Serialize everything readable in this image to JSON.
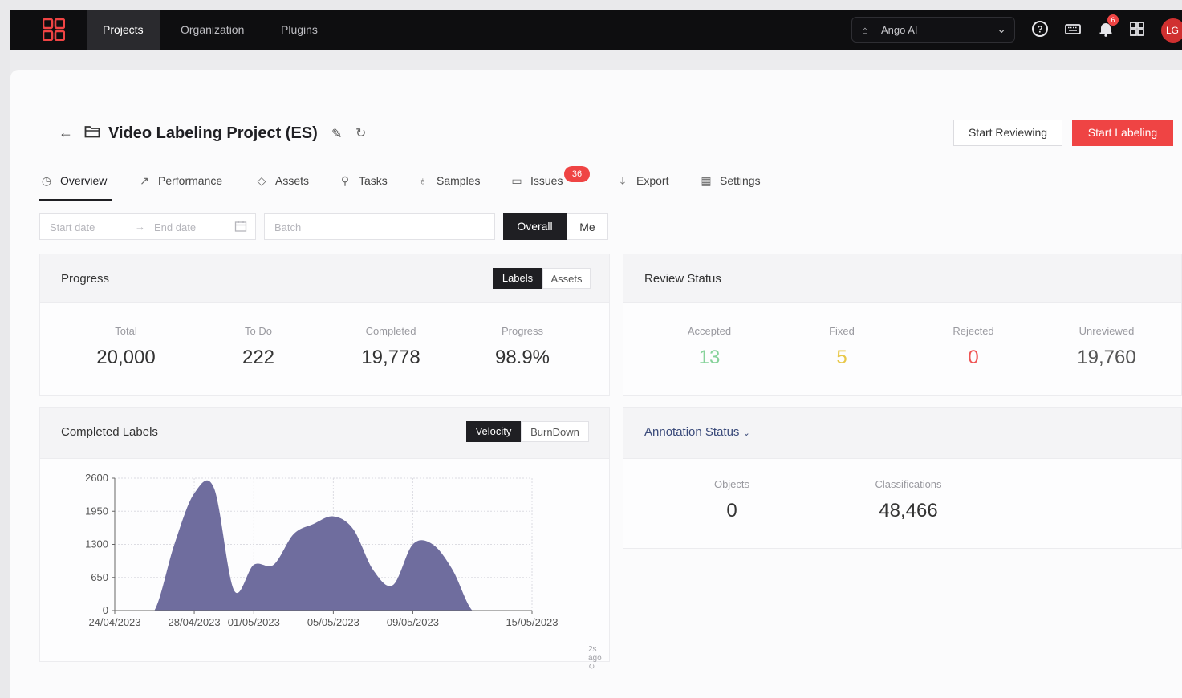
{
  "nav": {
    "items": [
      "Projects",
      "Organization",
      "Plugins"
    ],
    "org_name": "Ango AI",
    "notification_count": "6",
    "avatar_initials": "LG"
  },
  "project": {
    "title": "Video Labeling Project (ES)",
    "start_reviewing_label": "Start Reviewing",
    "start_labeling_label": "Start Labeling"
  },
  "tabs": [
    {
      "label": "Overview",
      "icon": "clock-icon"
    },
    {
      "label": "Performance",
      "icon": "trend-icon"
    },
    {
      "label": "Assets",
      "icon": "tag-icon"
    },
    {
      "label": "Tasks",
      "icon": "search-icon"
    },
    {
      "label": "Samples",
      "icon": "bulb-icon"
    },
    {
      "label": "Issues",
      "icon": "comment-icon"
    },
    {
      "label": "Export",
      "icon": "download-icon"
    },
    {
      "label": "Settings",
      "icon": "settings-icon"
    }
  ],
  "issues_count": "36",
  "filters": {
    "start_date_placeholder": "Start date",
    "end_date_placeholder": "End date",
    "batch_placeholder": "Batch",
    "overall_label": "Overall",
    "me_label": "Me"
  },
  "progress": {
    "title": "Progress",
    "toggle_on": "Labels",
    "toggle_off": "Assets",
    "stats": [
      {
        "label": "Total",
        "value": "20,000"
      },
      {
        "label": "To Do",
        "value": "222"
      },
      {
        "label": "Completed",
        "value": "19,778"
      },
      {
        "label": "Progress",
        "value": "98.9%"
      }
    ]
  },
  "review": {
    "title": "Review Status",
    "stats": [
      {
        "label": "Accepted",
        "value": "13",
        "color": "#86d29a"
      },
      {
        "label": "Fixed",
        "value": "5",
        "color": "#e8c84a"
      },
      {
        "label": "Rejected",
        "value": "0",
        "color": "#ef5555"
      },
      {
        "label": "Unreviewed",
        "value": "19,760",
        "color": "#555555"
      }
    ]
  },
  "completed_labels": {
    "title": "Completed Labels",
    "toggle_on": "Velocity",
    "toggle_off": "BurnDown",
    "updated": "2s ago"
  },
  "annotation": {
    "title": "Annotation Status",
    "stats": [
      {
        "label": "Objects",
        "value": "0"
      },
      {
        "label": "Classifications",
        "value": "48,466"
      }
    ]
  },
  "chart_data": {
    "type": "area",
    "x": [
      "24/04/2023",
      "25/04/2023",
      "26/04/2023",
      "27/04/2023",
      "28/04/2023",
      "29/04/2023",
      "30/04/2023",
      "01/05/2023",
      "02/05/2023",
      "03/05/2023",
      "04/05/2023",
      "05/05/2023",
      "06/05/2023",
      "07/05/2023",
      "08/05/2023",
      "09/05/2023",
      "10/05/2023",
      "11/05/2023",
      "12/05/2023",
      "13/05/2023",
      "14/05/2023",
      "15/05/2023"
    ],
    "series": [
      {
        "values": [
          0,
          0,
          0,
          1300,
          2300,
          2400,
          400,
          900,
          900,
          1500,
          1700,
          1850,
          1600,
          800,
          500,
          1300,
          1300,
          800,
          0,
          0,
          0,
          0
        ]
      }
    ],
    "x_tick_labels": [
      "24/04/2023",
      "28/04/2023",
      "01/05/2023",
      "05/05/2023",
      "09/05/2023",
      "15/05/2023"
    ],
    "y_ticks": [
      0,
      650,
      1300,
      1950,
      2600
    ],
    "ylim": [
      0,
      2600
    ],
    "grid": true,
    "color": "#6f6d9e"
  }
}
